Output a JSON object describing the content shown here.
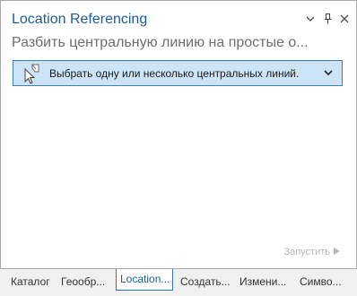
{
  "pane": {
    "title": "Location Referencing",
    "subtitle": "Разбить центральную линию на простые о...",
    "tool_dropdown_label": "Выбрать одну или несколько центральных линий.",
    "run_label": "Запустить"
  },
  "tabs": [
    {
      "label": "Каталог"
    },
    {
      "label": "Геообр..."
    },
    {
      "label": "Location..."
    },
    {
      "label": "Создать..."
    },
    {
      "label": "Измени..."
    },
    {
      "label": "Симво..."
    }
  ],
  "colors": {
    "title": "#1b5d9c",
    "dropdown_bg": "#cce4f7",
    "dropdown_border": "#3c7fb1",
    "active_tab_border": "#2f77b8"
  },
  "icons": [
    "chevron-down-icon",
    "pin-icon",
    "close-icon",
    "select-centerline-tool-icon",
    "chevron-down-icon",
    "play-icon"
  ]
}
